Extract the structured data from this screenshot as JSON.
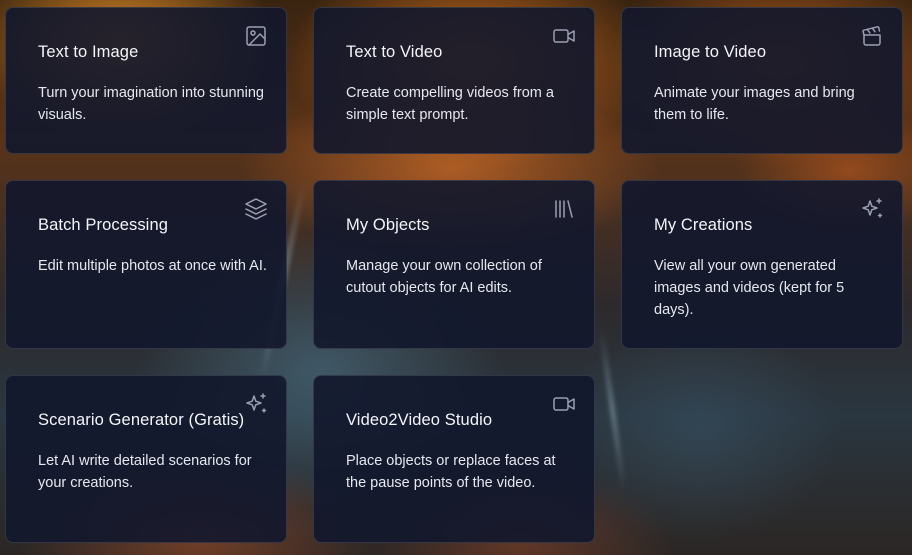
{
  "cards": [
    {
      "title": "Text to Image",
      "description": "Turn your imagination into stunning visuals.",
      "icon": "image-icon"
    },
    {
      "title": "Text to Video",
      "description": "Create compelling videos from a simple text prompt.",
      "icon": "video-camera-icon"
    },
    {
      "title": "Image to Video",
      "description": "Animate your images and bring them to life.",
      "icon": "clapperboard-icon"
    },
    {
      "title": "Batch Processing",
      "description": "Edit multiple photos at once with AI.",
      "icon": "layers-icon"
    },
    {
      "title": "My Objects",
      "description": "Manage your own collection of cutout objects for AI edits.",
      "icon": "library-icon"
    },
    {
      "title": "My Creations",
      "description": "View all your own generated images and videos (kept for 5 days).",
      "icon": "sparkles-icon"
    },
    {
      "title": "Scenario Generator (Gratis)",
      "description": "Let AI write detailed scenarios for your creations.",
      "icon": "sparkles-icon"
    },
    {
      "title": "Video2Video Studio",
      "description": "Place objects or replace faces at the pause points of the video.",
      "icon": "video-camera-icon"
    }
  ],
  "colors": {
    "card_background": "#12172c",
    "card_border": "#2a3048",
    "text_primary": "#f4f5f8",
    "icon_stroke": "#9aa0b2"
  }
}
